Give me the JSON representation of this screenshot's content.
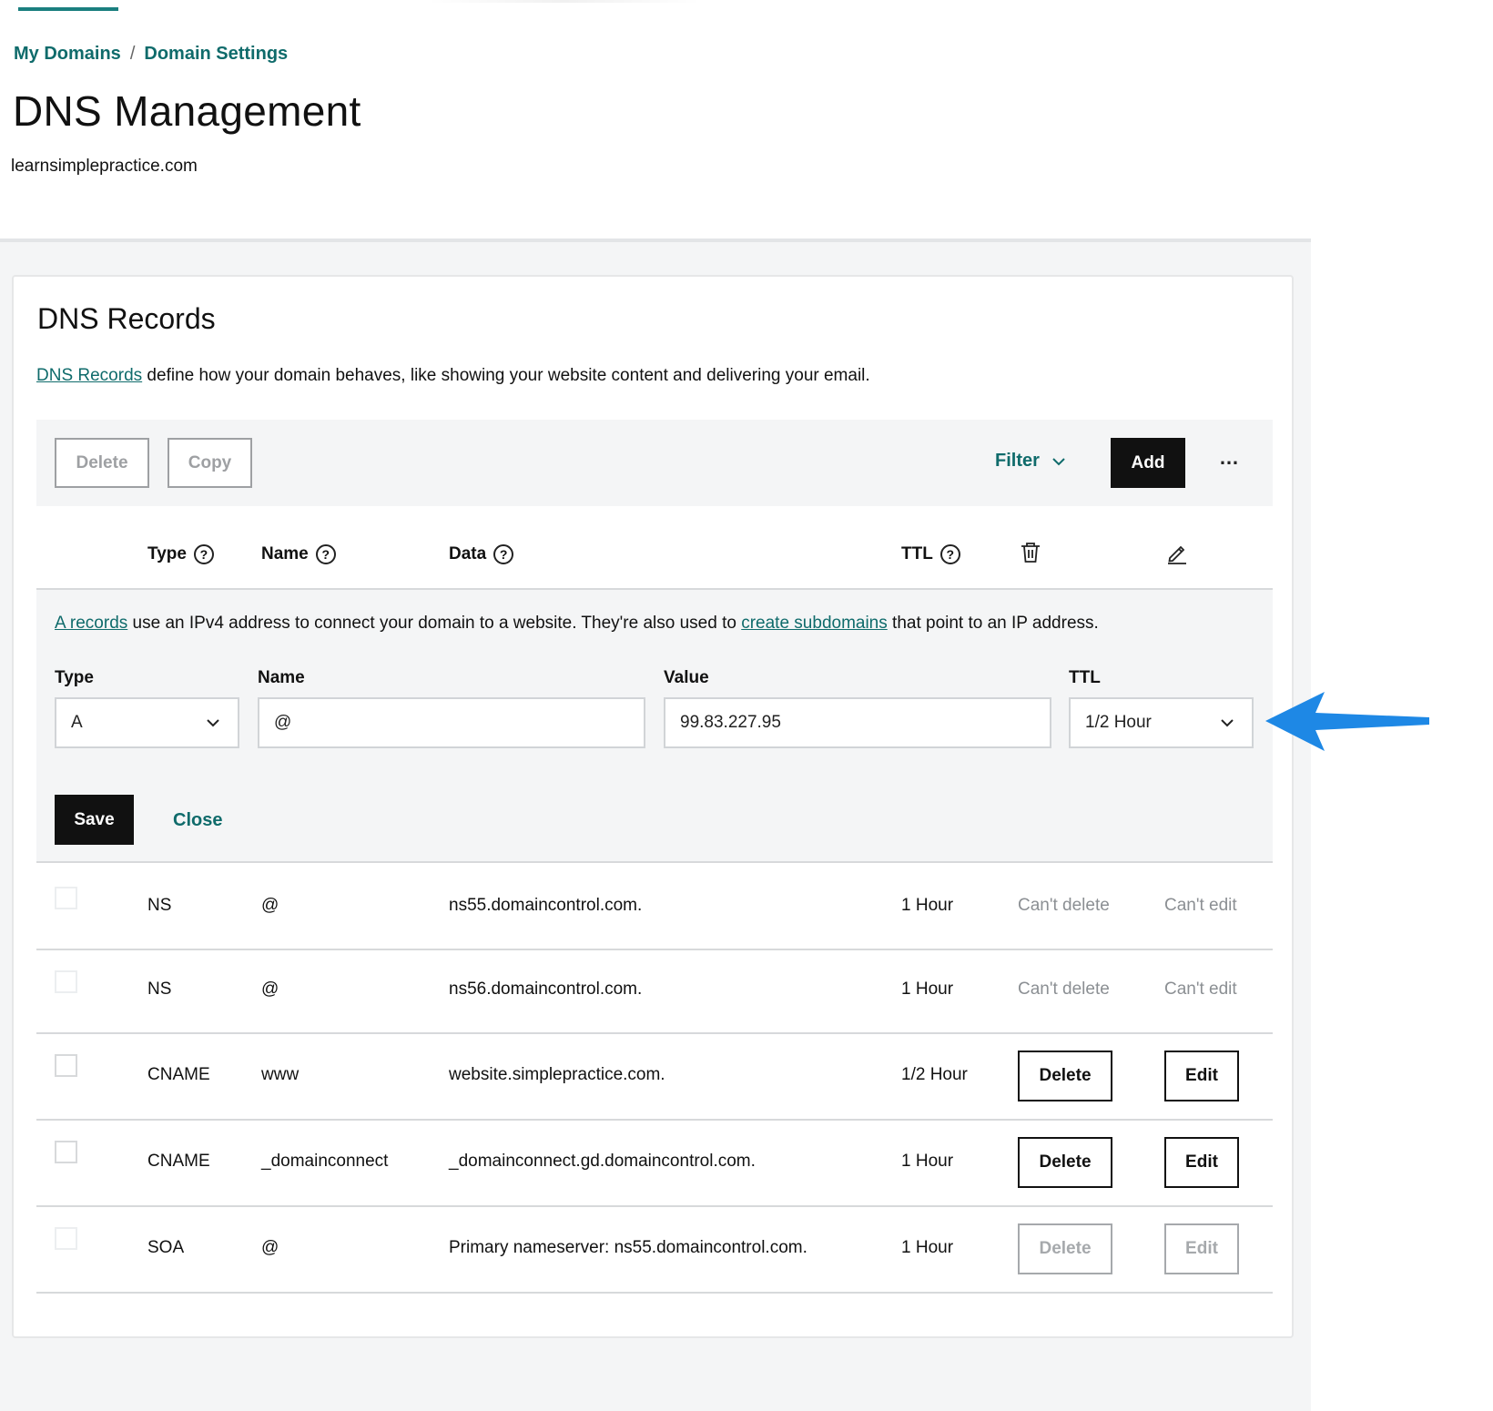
{
  "breadcrumb": {
    "items": [
      "My Domains",
      "Domain Settings"
    ],
    "separator": "/"
  },
  "page": {
    "title": "DNS Management",
    "domain": "learnsimplepractice.com"
  },
  "card": {
    "title": "DNS Records",
    "desc_link": "DNS Records",
    "desc_text": " define how your domain behaves, like showing your website content and delivering your email."
  },
  "toolbar": {
    "delete_label": "Delete",
    "copy_label": "Copy",
    "filter_label": "Filter",
    "add_label": "Add",
    "more_label": "…"
  },
  "table": {
    "headers": {
      "type": "Type",
      "name": "Name",
      "data": "Data",
      "ttl": "TTL"
    }
  },
  "edit_form": {
    "desc_link1": "A records",
    "desc_text1": " use an IPv4 address to connect your domain to a website. They're also used to ",
    "desc_link2": "create subdomains",
    "desc_text2": " that point to an IP address.",
    "type_label": "Type",
    "type_value": "A",
    "name_label": "Name",
    "name_value": "@",
    "value_label": "Value",
    "value_value": "99.83.227.95",
    "ttl_label": "TTL",
    "ttl_value": "1/2 Hour",
    "save_label": "Save",
    "close_label": "Close"
  },
  "records": [
    {
      "type": "NS",
      "name": "@",
      "data": "ns55.domaincontrol.com.",
      "ttl": "1 Hour",
      "delete": "Can't delete",
      "edit": "Can't edit"
    },
    {
      "type": "NS",
      "name": "@",
      "data": "ns56.domaincontrol.com.",
      "ttl": "1 Hour",
      "delete": "Can't delete",
      "edit": "Can't edit"
    },
    {
      "type": "CNAME",
      "name": "www",
      "data": "website.simplepractice.com.",
      "ttl": "1/2 Hour",
      "delete": "Delete",
      "edit": "Edit"
    },
    {
      "type": "CNAME",
      "name": "_domainconnect",
      "data": "_domainconnect.gd.domaincontrol.com.",
      "ttl": "1 Hour",
      "delete": "Delete",
      "edit": "Edit"
    },
    {
      "type": "SOA",
      "name": "@",
      "data": "Primary nameserver: ns55.domaincontrol.com.",
      "ttl": "1 Hour",
      "delete": "Delete",
      "edit": "Edit"
    }
  ],
  "colors": {
    "accent": "#0f6b6b",
    "annotation_arrow": "#1e88e5",
    "primary_button": "#111111"
  },
  "icons": {
    "help": "question-circle-icon",
    "delete_column": "trash-icon",
    "edit_column": "pencil-icon",
    "dropdown": "chevron-down-icon",
    "more": "ellipsis-icon",
    "annotation": "arrow-left-icon"
  }
}
